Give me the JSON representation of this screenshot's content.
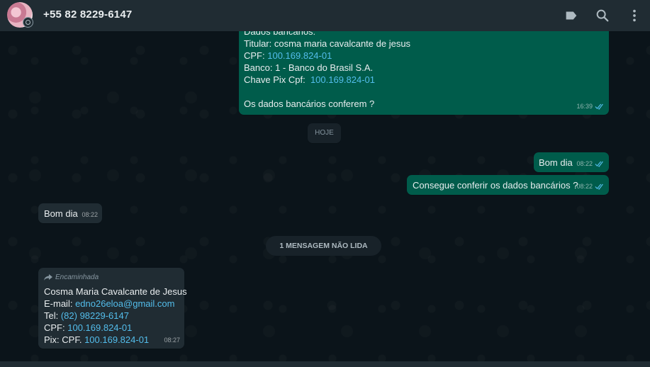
{
  "header": {
    "contact_name": "+55 82 8229-6147",
    "icons": [
      "label-icon",
      "search-icon",
      "menu-icon"
    ]
  },
  "messages": {
    "bank": {
      "line0": "Dados bancários:",
      "titular": "Titular: cosma maria cavalcante de jesus",
      "cpf_label": "CPF: ",
      "cpf_value": "100.169.824-01",
      "banco": "Banco: 1 - Banco do Brasil S.A.",
      "pix_label": "Chave Pix Cpf:  ",
      "pix_value": "100.169.824-01",
      "question": "Os dados bancários conferem ?",
      "time": "16:39"
    },
    "date_pill": "HOJE",
    "out1": {
      "text": "Bom dia",
      "time": "08:22"
    },
    "out2": {
      "text": "Consegue conferir os dados bancários ?",
      "time": "08:22"
    },
    "in1": {
      "text": "Bom dia",
      "time": "08:22"
    },
    "unread_pill": "1 MENSAGEM NÃO LIDA",
    "forwarded": {
      "label": "Encaminhada",
      "name": "Cosma Maria Cavalcante de Jesus",
      "email_label": "E-mail: ",
      "email_value": "edno26eloa@gmail.com",
      "tel_label": "Tel: ",
      "tel_value": "(82) 98229-6147",
      "cpf_label": "CPF: ",
      "cpf_value": "100.169.824-01",
      "pix_label": "Pix: CPF. ",
      "pix_value": "100.169.824-01",
      "time": "08:27"
    }
  },
  "colors": {
    "outgoing": "#005c4b",
    "incoming": "#202c33",
    "link": "#53bdeb",
    "read_ticks": "#53bdeb"
  }
}
